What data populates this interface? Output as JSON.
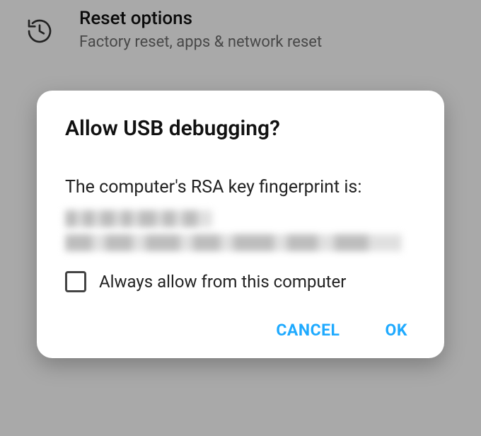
{
  "background": {
    "row": {
      "icon": "history-reset-icon",
      "title": "Reset options",
      "subtitle": "Factory reset, apps & network reset"
    }
  },
  "dialog": {
    "title": "Allow USB debugging?",
    "message": "The computer's RSA key fingerprint is:",
    "checkbox_label": "Always allow from this computer",
    "buttons": {
      "cancel": "CANCEL",
      "ok": "OK"
    }
  },
  "colors": {
    "accent": "#1faaff"
  }
}
